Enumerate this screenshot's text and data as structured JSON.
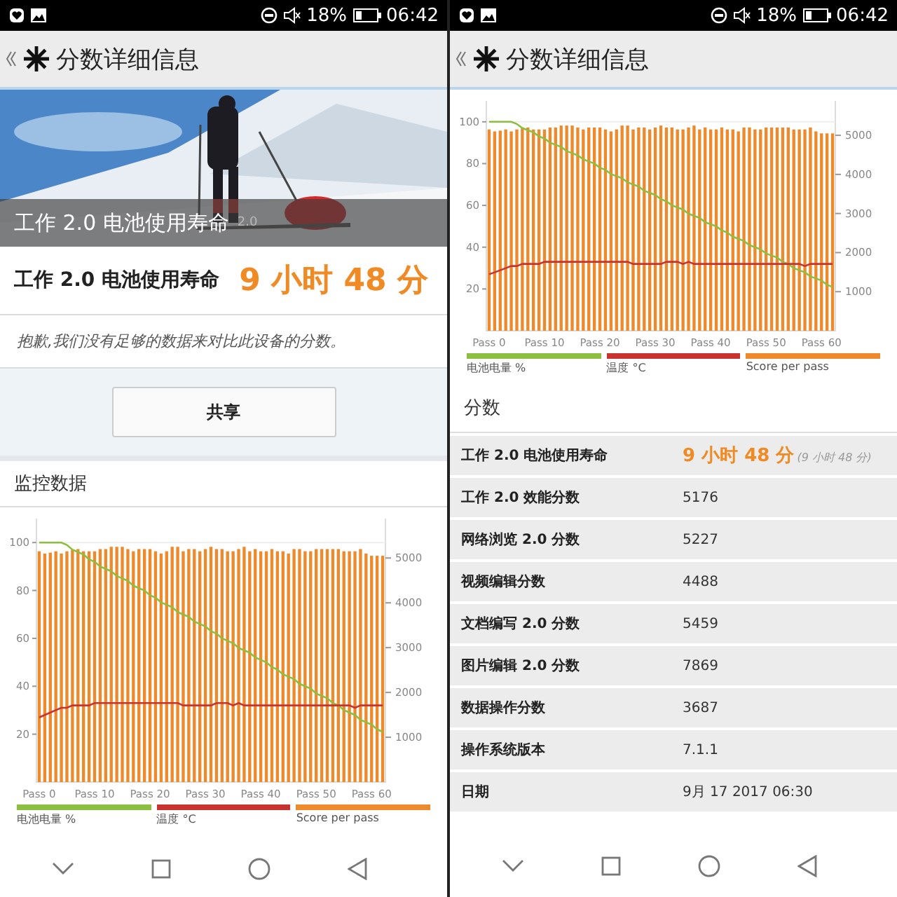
{
  "screens": [
    {
      "status_bar": {
        "battery": "18%",
        "time": "06:42"
      },
      "header": {
        "title": "分数详细信息"
      },
      "hero": {
        "kind": "picture",
        "caption": "工作 2.0 电池使用寿命",
        "caption_extra": "2.0"
      },
      "result": {
        "label": "工作 2.0 电池使用寿命",
        "value": "9 小时 48 分"
      },
      "note": "抱歉,我们没有足够的数据来对比此设备的分数。",
      "share_button": "共享",
      "monitor": {
        "title": "监控数据",
        "chart_data": {
          "type": "bar",
          "categories": [
            "Pass 0",
            null,
            null,
            null,
            null,
            null,
            null,
            null,
            null,
            null,
            "Pass 10",
            null,
            null,
            null,
            null,
            null,
            null,
            null,
            null,
            null,
            "Pass 20",
            null,
            null,
            null,
            null,
            null,
            null,
            null,
            null,
            null,
            "Pass 30",
            null,
            null,
            null,
            null,
            null,
            null,
            null,
            null,
            null,
            "Pass 40",
            null,
            null,
            null,
            null,
            null,
            null,
            null,
            null,
            null,
            "Pass 50",
            null,
            null,
            null,
            null,
            null,
            null,
            null,
            null,
            null,
            "Pass 60",
            null,
            null
          ],
          "ylim": [
            0,
            110
          ],
          "yticks": [
            20,
            40,
            60,
            80,
            100
          ],
          "y2lim": [
            0,
            5880
          ],
          "y2ticks": [
            1000,
            2000,
            3000,
            4000,
            5000
          ],
          "series": [
            {
              "name": "电池电量 %",
              "color": "#8cbf3f",
              "type": "line",
              "values": [
                100,
                100,
                100,
                100,
                100,
                99,
                97,
                96,
                95,
                93,
                92,
                90,
                89,
                88,
                86,
                85,
                84,
                82,
                81,
                80,
                78,
                77,
                75,
                74,
                73,
                71,
                70,
                69,
                67,
                66,
                65,
                63,
                62,
                60,
                59,
                58,
                56,
                55,
                54,
                52,
                51,
                50,
                48,
                47,
                45,
                44,
                43,
                41,
                40,
                39,
                37,
                36,
                35,
                33,
                32,
                30,
                29,
                28,
                26,
                25,
                24,
                22,
                21
              ]
            },
            {
              "name": "温度 °C",
              "color": "#c8332f",
              "type": "line",
              "values": [
                27,
                28,
                29,
                30,
                31,
                31,
                32,
                32,
                32,
                32,
                33,
                33,
                33,
                33,
                33,
                33,
                33,
                33,
                33,
                33,
                33,
                33,
                33,
                33,
                33,
                33,
                32,
                32,
                32,
                32,
                32,
                32,
                33,
                33,
                33,
                32,
                33,
                32,
                32,
                32,
                32,
                32,
                32,
                32,
                32,
                32,
                32,
                32,
                32,
                32,
                32,
                32,
                32,
                32,
                32,
                32,
                32,
                31,
                32,
                32,
                32,
                32,
                32
              ]
            },
            {
              "name": "Score per pass",
              "color": "#ef8a2c",
              "type": "bar",
              "axis": "y2",
              "values": [
                5150,
                5100,
                5120,
                5150,
                5100,
                5150,
                5180,
                5200,
                5150,
                5150,
                5150,
                5200,
                5200,
                5250,
                5250,
                5250,
                5200,
                5150,
                5200,
                5200,
                5200,
                5150,
                5100,
                5150,
                5250,
                5250,
                5150,
                5200,
                5200,
                5150,
                5200,
                5250,
                5200,
                5200,
                5150,
                5150,
                5200,
                5250,
                5150,
                5200,
                5150,
                5150,
                5200,
                5150,
                5150,
                5100,
                5200,
                5200,
                5150,
                5150,
                5200,
                5200,
                5200,
                5200,
                5200,
                5150,
                5150,
                5150,
                5200,
                5100,
                5050,
                5050,
                5050
              ]
            }
          ]
        }
      }
    },
    {
      "status_bar": {
        "battery": "18%",
        "time": "06:42"
      },
      "header": {
        "title": "分数详细信息"
      },
      "monitor": {
        "chart_data": {
          "type": "bar",
          "categories": [
            "Pass 0",
            null,
            null,
            null,
            null,
            null,
            null,
            null,
            null,
            null,
            "Pass 10",
            null,
            null,
            null,
            null,
            null,
            null,
            null,
            null,
            null,
            "Pass 20",
            null,
            null,
            null,
            null,
            null,
            null,
            null,
            null,
            null,
            "Pass 30",
            null,
            null,
            null,
            null,
            null,
            null,
            null,
            null,
            null,
            "Pass 40",
            null,
            null,
            null,
            null,
            null,
            null,
            null,
            null,
            null,
            "Pass 50",
            null,
            null,
            null,
            null,
            null,
            null,
            null,
            null,
            null,
            "Pass 60",
            null,
            null
          ],
          "ylim": [
            0,
            110
          ],
          "yticks": [
            20,
            40,
            60,
            80,
            100
          ],
          "y2lim": [
            0,
            5880
          ],
          "y2ticks": [
            1000,
            2000,
            3000,
            4000,
            5000
          ],
          "series": [
            {
              "name": "电池电量 %",
              "color": "#8cbf3f",
              "type": "line",
              "values": [
                100,
                100,
                100,
                100,
                100,
                99,
                97,
                96,
                95,
                93,
                92,
                90,
                89,
                88,
                86,
                85,
                84,
                82,
                81,
                80,
                78,
                77,
                75,
                74,
                73,
                71,
                70,
                69,
                67,
                66,
                65,
                63,
                62,
                60,
                59,
                58,
                56,
                55,
                54,
                52,
                51,
                50,
                48,
                47,
                45,
                44,
                43,
                41,
                40,
                39,
                37,
                36,
                35,
                33,
                32,
                30,
                29,
                28,
                26,
                25,
                24,
                22,
                21
              ]
            },
            {
              "name": "温度 °C",
              "color": "#c8332f",
              "type": "line",
              "values": [
                27,
                28,
                29,
                30,
                31,
                31,
                32,
                32,
                32,
                32,
                33,
                33,
                33,
                33,
                33,
                33,
                33,
                33,
                33,
                33,
                33,
                33,
                33,
                33,
                33,
                33,
                32,
                32,
                32,
                32,
                32,
                32,
                33,
                33,
                33,
                32,
                33,
                32,
                32,
                32,
                32,
                32,
                32,
                32,
                32,
                32,
                32,
                32,
                32,
                32,
                32,
                32,
                32,
                32,
                32,
                32,
                32,
                31,
                32,
                32,
                32,
                32,
                32
              ]
            },
            {
              "name": "Score per pass",
              "color": "#ef8a2c",
              "type": "bar",
              "axis": "y2",
              "values": [
                5150,
                5100,
                5120,
                5150,
                5100,
                5150,
                5180,
                5200,
                5150,
                5150,
                5150,
                5200,
                5200,
                5250,
                5250,
                5250,
                5200,
                5150,
                5200,
                5200,
                5200,
                5150,
                5100,
                5150,
                5250,
                5250,
                5150,
                5200,
                5200,
                5150,
                5200,
                5250,
                5200,
                5200,
                5150,
                5150,
                5200,
                5250,
                5150,
                5200,
                5150,
                5150,
                5200,
                5150,
                5150,
                5100,
                5200,
                5200,
                5150,
                5150,
                5200,
                5200,
                5200,
                5200,
                5200,
                5150,
                5150,
                5150,
                5200,
                5100,
                5050,
                5050,
                5050
              ]
            }
          ]
        }
      },
      "scores": {
        "title": "分数",
        "rows": [
          {
            "label": "工作 2.0 电池使用寿命",
            "value": "9 小时 48 分",
            "detail": "(9 小时 48 分)",
            "highlight": true
          },
          {
            "label": "工作 2.0 效能分数",
            "value": "5176",
            "highlight": false
          },
          {
            "label": "网络浏览 2.0 分数",
            "value": "5227",
            "highlight": false
          },
          {
            "label": "视频编辑分数",
            "value": "4488",
            "highlight": false
          },
          {
            "label": "文档编写 2.0 分数",
            "value": "5459",
            "highlight": false
          },
          {
            "label": "图片编辑 2.0 分数",
            "value": "7869",
            "highlight": false
          },
          {
            "label": "数据操作分数",
            "value": "3687",
            "highlight": false
          },
          {
            "label": "操作系统版本",
            "value": "7.1.1",
            "highlight": false
          },
          {
            "label": "日期",
            "value": "9月 17 2017 06:30",
            "highlight": false
          }
        ]
      }
    }
  ]
}
